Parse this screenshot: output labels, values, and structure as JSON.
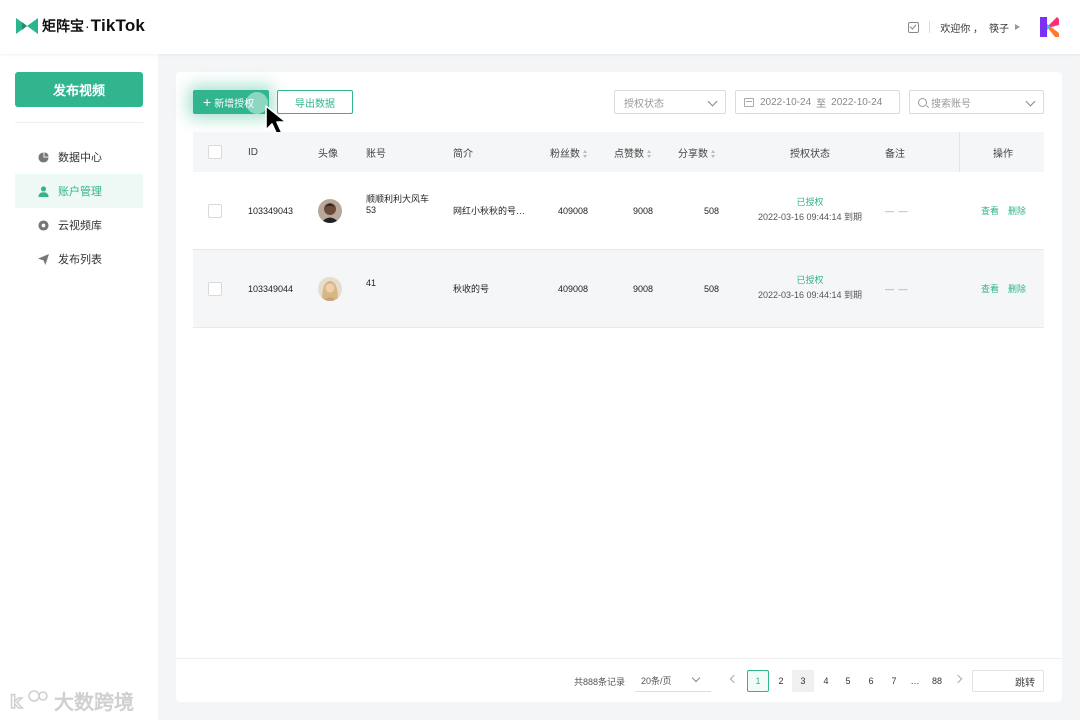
{
  "header": {
    "brand_cn": "矩阵宝",
    "brand_dot": "·",
    "brand_tiktok": "TikTok",
    "welcome": "欢迎你 ，",
    "username": "筷子"
  },
  "sidebar": {
    "publish_label": "发布视频",
    "items": [
      {
        "label": "数据中心",
        "icon": "pie-chart-icon",
        "active": false
      },
      {
        "label": "账户管理",
        "icon": "user-icon",
        "active": true
      },
      {
        "label": "云视频库",
        "icon": "cloud-video-icon",
        "active": false
      },
      {
        "label": "发布列表",
        "icon": "send-icon",
        "active": false
      }
    ]
  },
  "toolbar": {
    "add_label": "新增授权",
    "export_label": "导出数据",
    "status_placeholder": "授权状态",
    "date_start": "2022-10-24",
    "date_sep": "至",
    "date_end": "2022-10-24",
    "search_placeholder": "搜索账号"
  },
  "table": {
    "columns": [
      "ID",
      "头像",
      "账号",
      "简介",
      "粉丝数",
      "点赞数",
      "分享数",
      "授权状态",
      "备注",
      "操作"
    ],
    "rows": [
      {
        "id": "103349043",
        "account": "顺顺利利大风车53",
        "account_line1": "顺顺利利大风车",
        "account_line2": "53",
        "intro": "网红小秋秋的号…",
        "fans": "409008",
        "likes": "9008",
        "shares": "508",
        "status": "已授权",
        "expiry": "2022-03-16 09:44:14 到期",
        "remark": "— —",
        "action_view": "查看",
        "action_delete": "删除"
      },
      {
        "id": "103349044",
        "account": "41",
        "account_line1": "41",
        "account_line2": "",
        "intro": "秋收的号",
        "fans": "409008",
        "likes": "9008",
        "shares": "508",
        "status": "已授权",
        "expiry": "2022-03-16 09:44:14 到期",
        "remark": "— —",
        "action_view": "查看",
        "action_delete": "删除"
      }
    ]
  },
  "pagination": {
    "total": "共888条记录",
    "page_size": "20条/页",
    "pages": [
      "1",
      "2",
      "3",
      "4",
      "5",
      "6",
      "7",
      "…",
      "88"
    ],
    "current": "1",
    "jump_label": "跳转"
  },
  "watermark": "大数跨境",
  "colors": {
    "accent": "#30b58f",
    "background": "#f4f5f7"
  }
}
